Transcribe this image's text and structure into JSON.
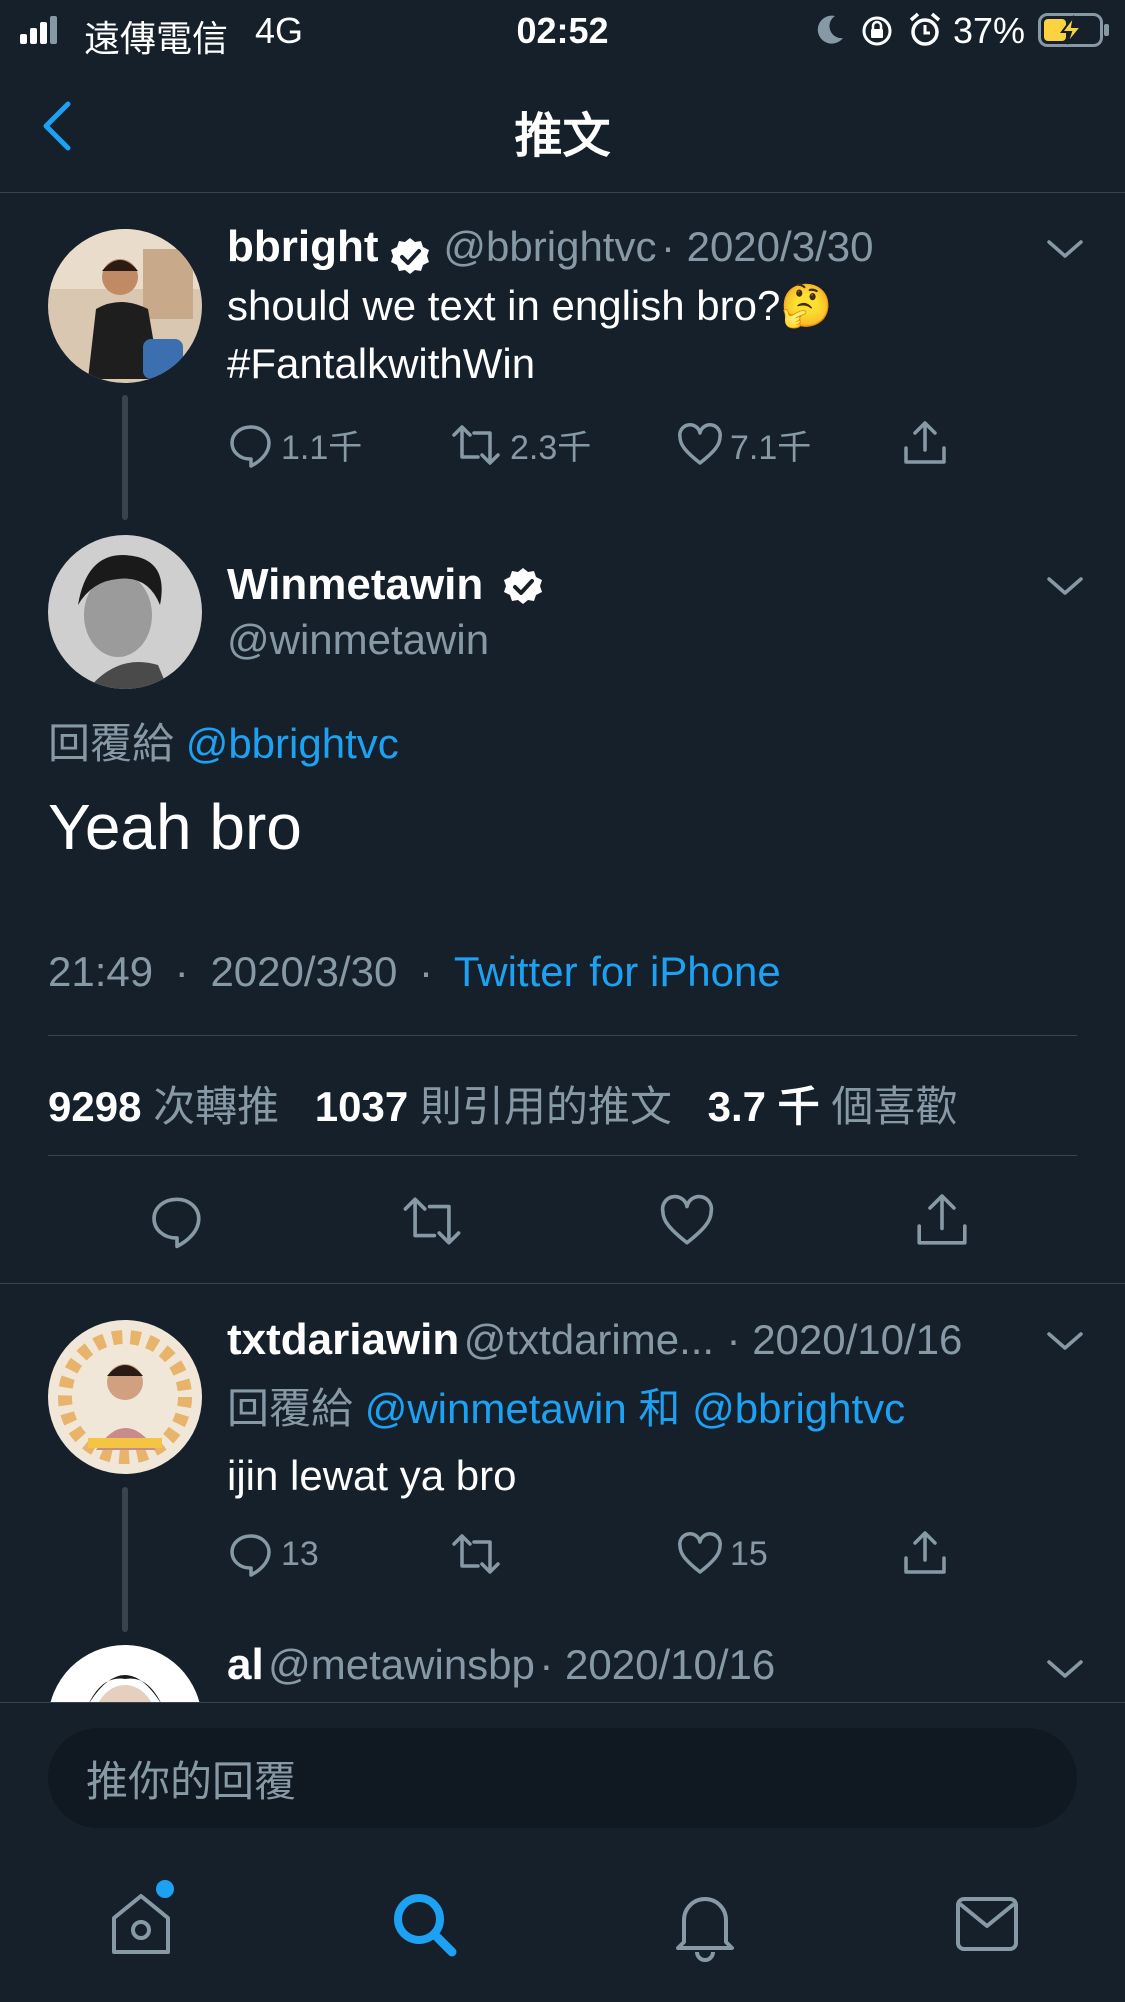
{
  "status_bar": {
    "carrier": "遠傳電信",
    "network": "4G",
    "time": "02:52",
    "battery": "37%"
  },
  "nav": {
    "title": "推文"
  },
  "tweet1": {
    "name": "bbright",
    "handle": "@bbrightvc",
    "date": "· 2020/3/30",
    "text": "should we text in english bro?",
    "emoji": "🤔",
    "hashtag": "#FantalkwithWin",
    "replies": "1.1千",
    "retweets": "2.3千",
    "likes": "7.1千"
  },
  "main_tweet": {
    "name": "Winmetawin",
    "handle": "@winmetawin",
    "reply_to_label": "回覆給",
    "reply_to": "@bbrightvc",
    "text": "Yeah bro",
    "time": "21:49",
    "date": "2020/3/30",
    "source": "Twitter for iPhone",
    "retweet_count": "9298",
    "retweet_label": "次轉推",
    "quote_count": "1037",
    "quote_label": "則引用的推文",
    "like_count": "3.7 千",
    "like_label": "個喜歡"
  },
  "reply1": {
    "name": "txtdariawin",
    "handle": "@txtdarime...",
    "date": "· 2020/10/16",
    "reply_to_label": "回覆給",
    "reply_to_a": "@winmetawin",
    "reply_to_and": "和",
    "reply_to_b": "@bbrightvc",
    "text": "ijin lewat ya bro",
    "replies": "13",
    "likes": "15"
  },
  "reply2": {
    "name": "al",
    "handle": "@metawinsbp",
    "date": "· 2020/10/16"
  },
  "composer": {
    "placeholder": "推你的回覆"
  },
  "tab_bar": {
    "items": [
      "home-icon",
      "search-icon",
      "notifications-icon",
      "messages-icon"
    ]
  },
  "colors": {
    "background": "#15202b",
    "accent": "#1da1f2",
    "muted": "#8899a6",
    "divider": "#38444d"
  }
}
